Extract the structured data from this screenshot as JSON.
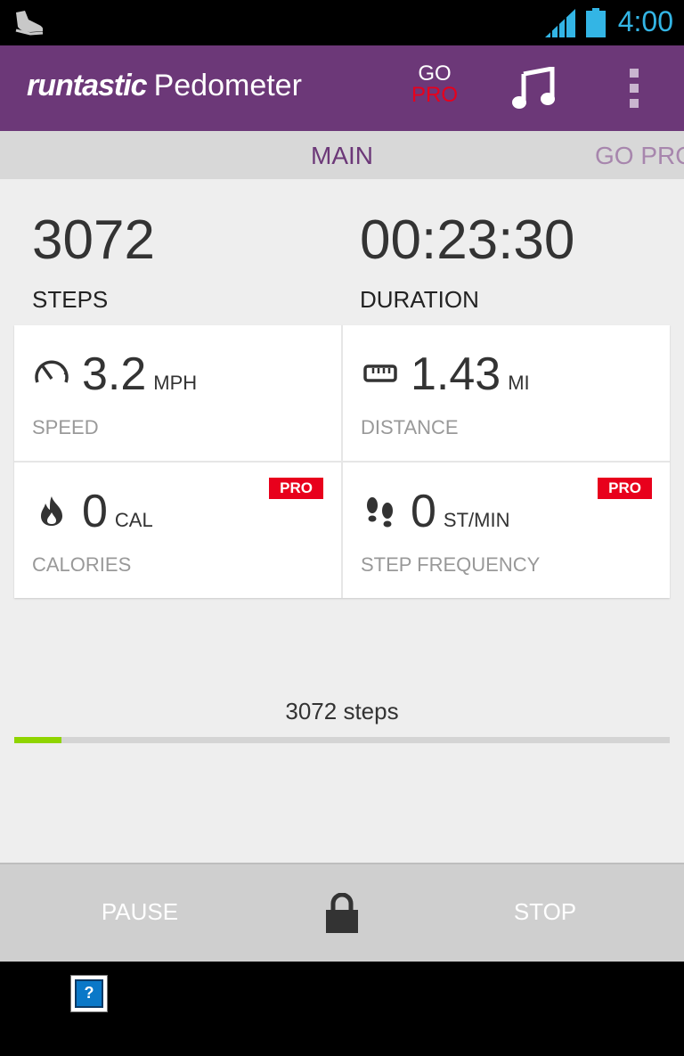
{
  "statusbar": {
    "time": "4:00",
    "notification_icon": "shoe-icon",
    "signal_icon": "signal-icon",
    "battery_icon": "battery-icon"
  },
  "actionbar": {
    "logo": "runtastic",
    "app_name": "Pedometer",
    "gopro_top": "GO",
    "gopro_bottom": "PRO",
    "music_icon": "music-note-icon",
    "overflow_icon": "overflow-menu-icon",
    "color": "#6c3878"
  },
  "tabs": {
    "main": "MAIN",
    "gopro": "GO PRO"
  },
  "stats": {
    "steps": {
      "value": "3072",
      "label": "STEPS"
    },
    "duration": {
      "value": "00:23:30",
      "label": "DURATION"
    }
  },
  "metrics": {
    "speed": {
      "value": "3.2",
      "unit": "MPH",
      "label": "SPEED",
      "icon": "speedometer-icon"
    },
    "distance": {
      "value": "1.43",
      "unit": "MI",
      "label": "DISTANCE",
      "icon": "ruler-icon"
    },
    "calories": {
      "value": "0",
      "unit": "CAL",
      "label": "CALORIES",
      "icon": "flame-icon",
      "badge": "PRO"
    },
    "step_frequency": {
      "value": "0",
      "unit": "ST/MIN",
      "label": "STEP FREQUENCY",
      "icon": "footprints-icon",
      "badge": "PRO"
    }
  },
  "progress": {
    "label": "3072 steps",
    "fraction": 0.072,
    "color": "#8fd400"
  },
  "controls": {
    "pause": "PAUSE",
    "stop": "STOP",
    "lock_icon": "lock-icon"
  },
  "nav": {
    "help_icon": "help-icon",
    "help_glyph": "?"
  }
}
